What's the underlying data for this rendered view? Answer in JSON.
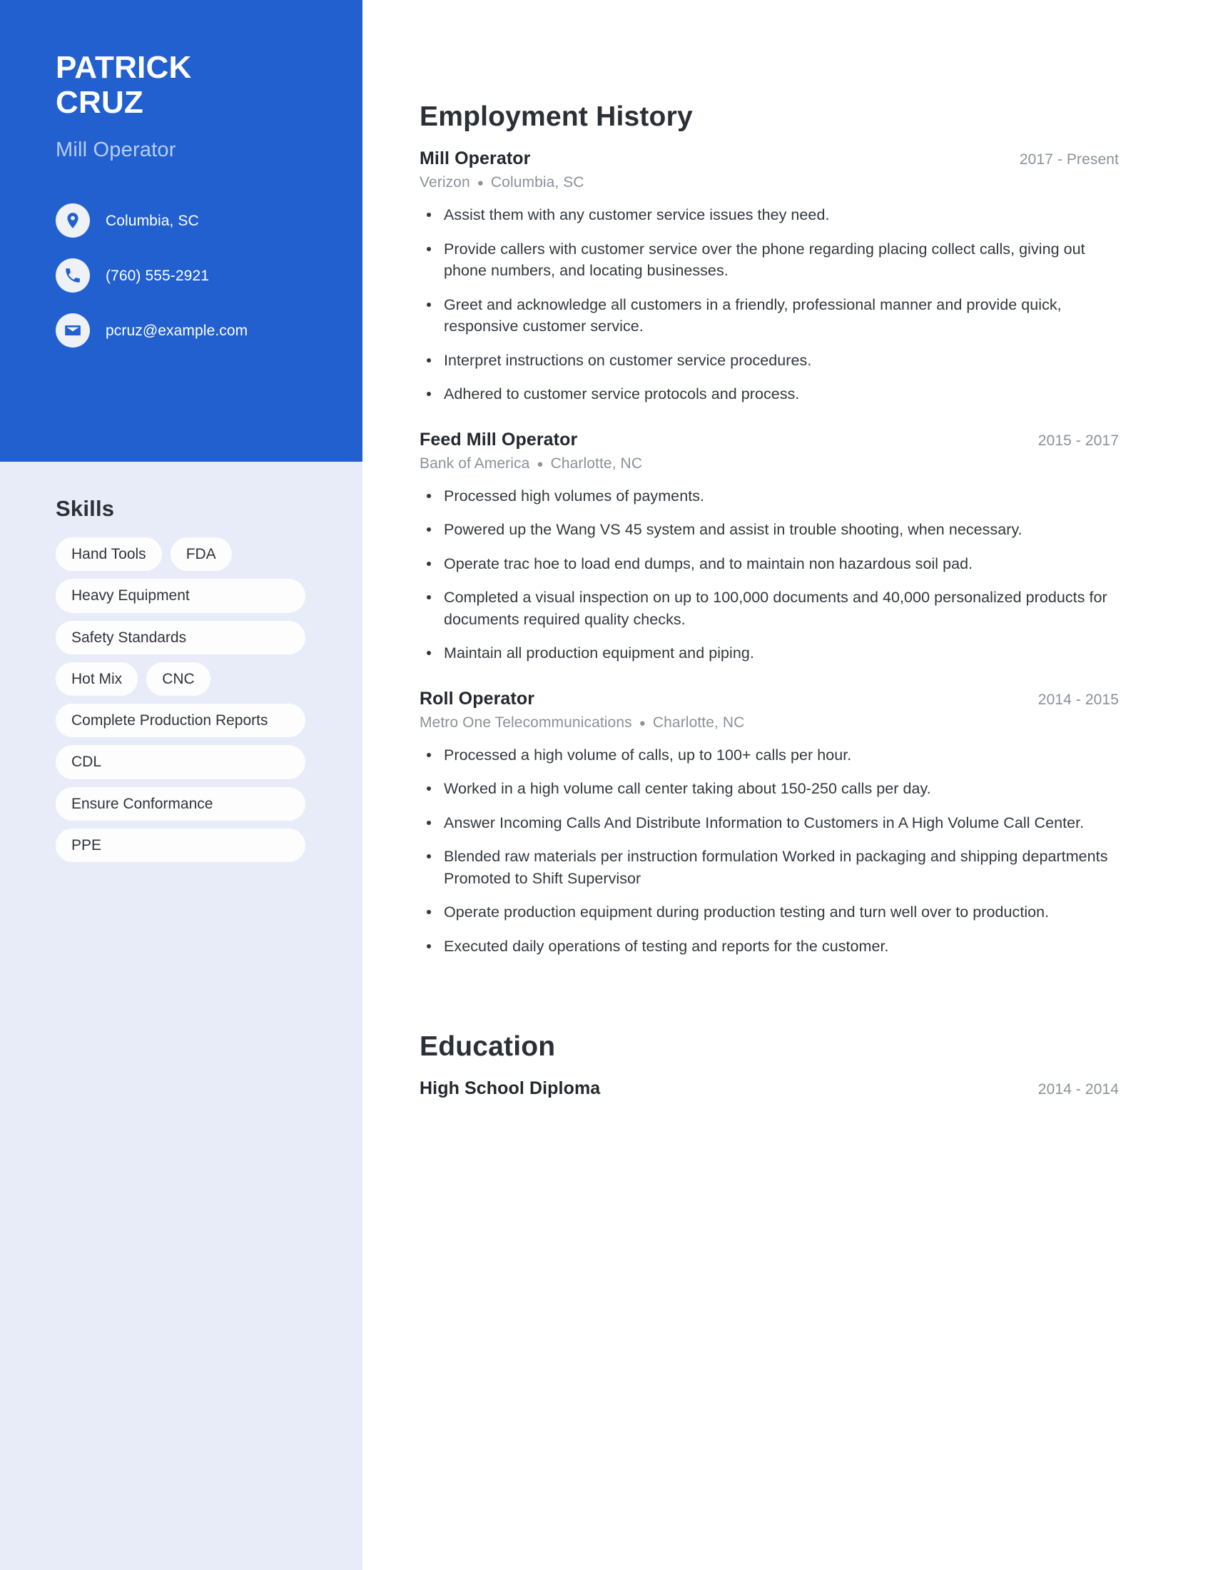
{
  "theme": {
    "primary_blue": "#2260d0",
    "sidebar_bg": "#e7ecf8",
    "chip_bg": "#fdfdfe",
    "muted_text": "#8b9099",
    "body_text": "#32373e",
    "subtitle_text": "#b8cdf0"
  },
  "sidebar": {
    "name_first": "PATRICK",
    "name_last": "CRUZ",
    "job_title": "Mill Operator",
    "contacts": [
      {
        "icon": "map-pin-icon",
        "value": "Columbia, SC"
      },
      {
        "icon": "phone-icon",
        "value": "(760) 555-2921"
      },
      {
        "icon": "envelope-icon",
        "value": "pcruz@example.com"
      }
    ],
    "skills_title": "Skills",
    "skills": [
      "Hand Tools",
      "FDA",
      "Heavy Equipment",
      "Safety Standards",
      "Hot Mix",
      "CNC",
      "Complete Production Reports",
      "CDL",
      "Ensure Conformance",
      "PPE"
    ]
  },
  "main": {
    "employment_title": "Employment History",
    "education_title": "Education",
    "separator": "●",
    "jobs": [
      {
        "role": "Mill Operator",
        "dates": "2017 - Present",
        "company": "Verizon",
        "location": "Columbia, SC",
        "bullets": [
          "Assist them with any customer service issues they need.",
          "Provide callers with customer service over the phone regarding placing collect calls, giving out phone numbers, and locating businesses.",
          "Greet and acknowledge all customers in a friendly, professional manner and provide quick, responsive customer service.",
          "Interpret instructions on customer service procedures.",
          "Adhered to customer service protocols and process."
        ]
      },
      {
        "role": "Feed Mill Operator",
        "dates": "2015 - 2017",
        "company": "Bank of America",
        "location": "Charlotte, NC",
        "bullets": [
          "Processed high volumes of payments.",
          "Powered up the Wang VS 45 system and assist in trouble shooting, when necessary.",
          "Operate trac hoe to load end dumps, and to maintain non hazardous soil pad.",
          "Completed a visual inspection on up to 100,000 documents and 40,000 personalized products for documents required quality checks.",
          "Maintain all production equipment and piping."
        ]
      },
      {
        "role": "Roll Operator",
        "dates": "2014 - 2015",
        "company": "Metro One Telecommunications",
        "location": "Charlotte, NC",
        "bullets": [
          "Processed a high volume of calls, up to 100+ calls per hour.",
          "Worked in a high volume call center taking about 150-250 calls per day.",
          "Answer Incoming Calls And Distribute Information to Customers in A High Volume Call Center.",
          "Blended raw materials per instruction formulation Worked in packaging and shipping departments Promoted to Shift Supervisor",
          "Operate production equipment during production testing and turn well over to production.",
          "Executed daily operations of testing and reports for the customer."
        ]
      }
    ],
    "education": [
      {
        "degree": "High School Diploma",
        "dates": "2014 - 2014"
      }
    ]
  }
}
